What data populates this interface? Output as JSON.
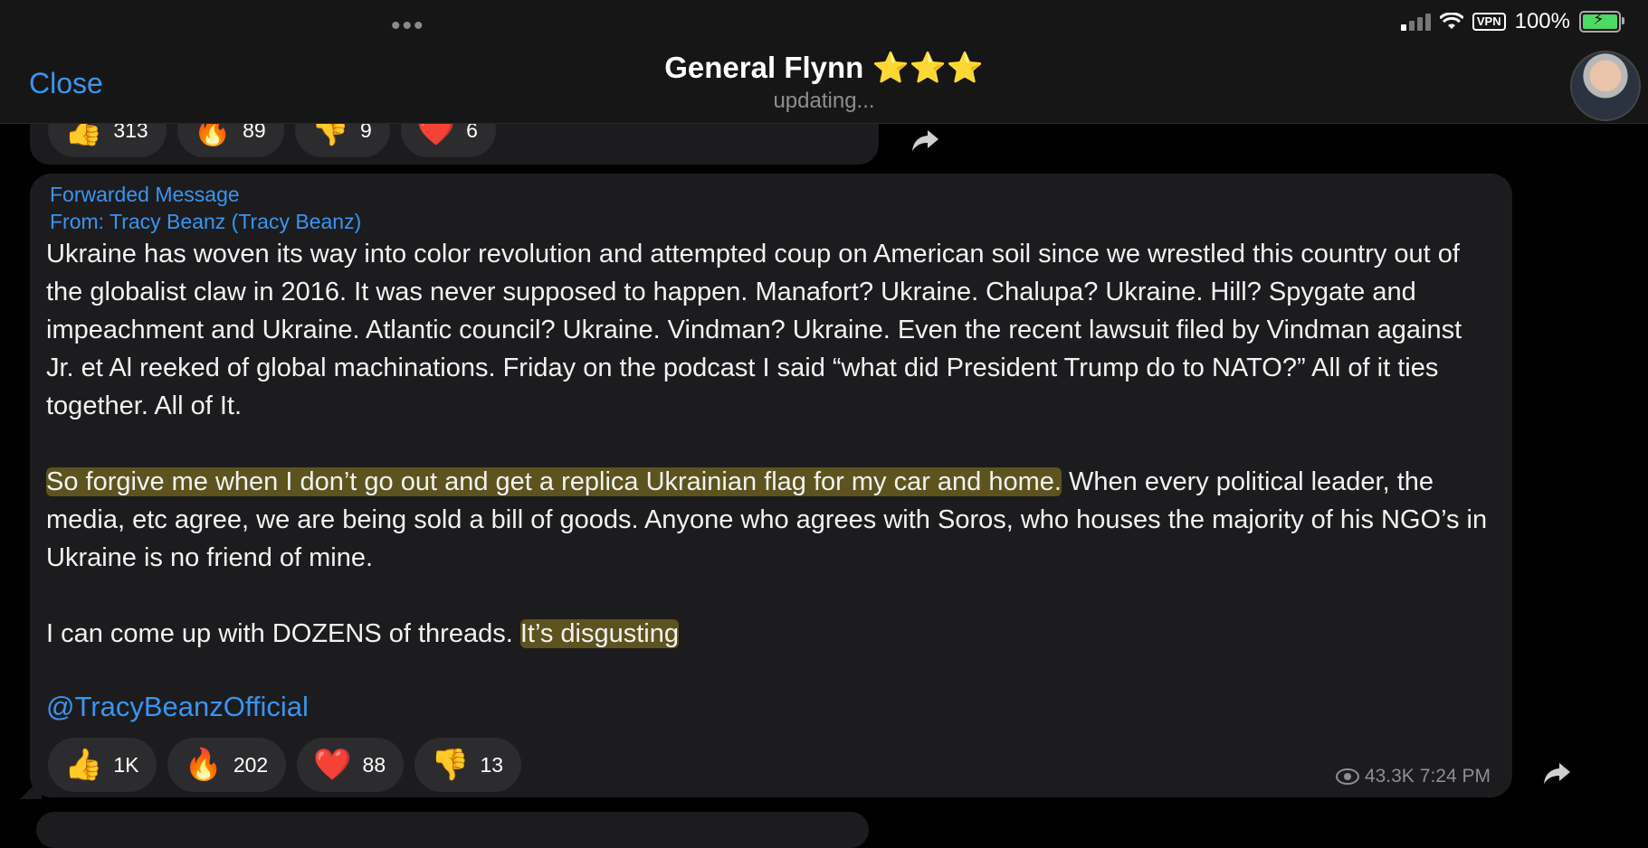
{
  "status_bar": {
    "battery": "100%",
    "vpn": "VPN"
  },
  "header": {
    "close_label": "Close",
    "title": "General Flynn ⭐⭐⭐",
    "subtitle": "updating..."
  },
  "prev_reactions": [
    {
      "emoji": "👍",
      "count": "313"
    },
    {
      "emoji": "🔥",
      "count": "89"
    },
    {
      "emoji": "👎",
      "count": "9"
    },
    {
      "emoji": "❤️",
      "count": "6"
    }
  ],
  "message": {
    "forward_label": "Forwarded Message",
    "from_label": "From: Tracy Beanz (Tracy Beanz)",
    "p1": "Ukraine has woven its way into color revolution and attempted coup on American soil since we wrestled this country out of the globalist claw in 2016. It was never supposed to happen. Manafort? Ukraine. Chalupa? Ukraine. Hill? Spygate and impeachment and Ukraine. Atlantic council? Ukraine. Vindman? Ukraine. Even the recent lawsuit filed by Vindman against Jr. et Al reeked of global machinations. Friday on the podcast I said “what did President Trump do to NATO?” All of it ties together. All of It.",
    "p2a": "So forgive me when I don’t go out and get a replica Ukrainian flag for my car and home.",
    "p2b": " When every political leader, the media, etc agree, we are being sold a bill of goods. Anyone who agrees with Soros, who houses the majority of his NGO’s in Ukraine is no friend of mine.",
    "p3a": "I can come up with DOZENS of threads. ",
    "p3b": "It’s disgusting",
    "mention": "@TracyBeanzOfficial",
    "views": "43.3K",
    "time": "7:24 PM"
  },
  "reactions": [
    {
      "emoji": "👍",
      "count": "1K"
    },
    {
      "emoji": "🔥",
      "count": "202"
    },
    {
      "emoji": "❤️",
      "count": "88"
    },
    {
      "emoji": "👎",
      "count": "13"
    }
  ]
}
